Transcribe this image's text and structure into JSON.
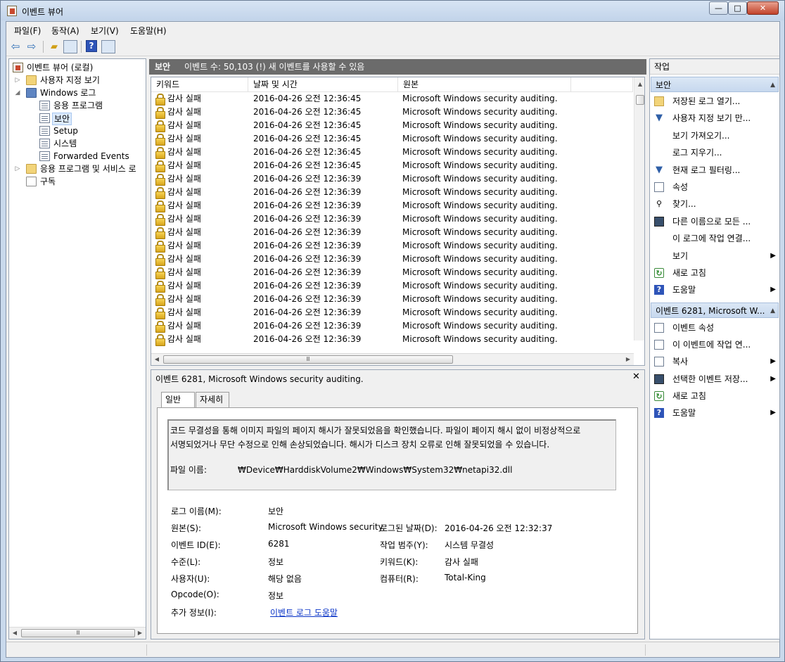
{
  "window": {
    "title": "이벤트 뷰어",
    "minimize": "—",
    "maximize": "□",
    "close": "✕"
  },
  "menu": [
    "파일(F)",
    "동작(A)",
    "보기(V)",
    "도움말(H)"
  ],
  "toolbar": {
    "back_icon": "back-arrow-icon",
    "forward_icon": "forward-arrow-icon",
    "help": "?"
  },
  "tree": {
    "root": "이벤트 뷰어 (로컬)",
    "custom_views": "사용자 지정 보기",
    "windows_logs": "Windows 로그",
    "logs": [
      "응용 프로그램",
      "보안",
      "Setup",
      "시스템",
      "Forwarded Events"
    ],
    "app_services": "응용 프로그램 및 서비스 로",
    "subscriptions": "구독"
  },
  "center": {
    "log_name": "보안",
    "count_text": "이벤트 수: 50,103 (!) 새 이벤트를 사용할 수 있음",
    "columns": [
      "키워드",
      "날짜 및 시간",
      "원본"
    ],
    "rows": [
      {
        "keyword": "감사 실패",
        "datetime": "2016-04-26 오전 12:36:45",
        "source": "Microsoft Windows security auditing."
      },
      {
        "keyword": "감사 실패",
        "datetime": "2016-04-26 오전 12:36:45",
        "source": "Microsoft Windows security auditing."
      },
      {
        "keyword": "감사 실패",
        "datetime": "2016-04-26 오전 12:36:45",
        "source": "Microsoft Windows security auditing."
      },
      {
        "keyword": "감사 실패",
        "datetime": "2016-04-26 오전 12:36:45",
        "source": "Microsoft Windows security auditing."
      },
      {
        "keyword": "감사 실패",
        "datetime": "2016-04-26 오전 12:36:45",
        "source": "Microsoft Windows security auditing."
      },
      {
        "keyword": "감사 실패",
        "datetime": "2016-04-26 오전 12:36:45",
        "source": "Microsoft Windows security auditing."
      },
      {
        "keyword": "감사 실패",
        "datetime": "2016-04-26 오전 12:36:39",
        "source": "Microsoft Windows security auditing."
      },
      {
        "keyword": "감사 실패",
        "datetime": "2016-04-26 오전 12:36:39",
        "source": "Microsoft Windows security auditing."
      },
      {
        "keyword": "감사 실패",
        "datetime": "2016-04-26 오전 12:36:39",
        "source": "Microsoft Windows security auditing."
      },
      {
        "keyword": "감사 실패",
        "datetime": "2016-04-26 오전 12:36:39",
        "source": "Microsoft Windows security auditing."
      },
      {
        "keyword": "감사 실패",
        "datetime": "2016-04-26 오전 12:36:39",
        "source": "Microsoft Windows security auditing."
      },
      {
        "keyword": "감사 실패",
        "datetime": "2016-04-26 오전 12:36:39",
        "source": "Microsoft Windows security auditing."
      },
      {
        "keyword": "감사 실패",
        "datetime": "2016-04-26 오전 12:36:39",
        "source": "Microsoft Windows security auditing."
      },
      {
        "keyword": "감사 실패",
        "datetime": "2016-04-26 오전 12:36:39",
        "source": "Microsoft Windows security auditing."
      },
      {
        "keyword": "감사 실패",
        "datetime": "2016-04-26 오전 12:36:39",
        "source": "Microsoft Windows security auditing."
      },
      {
        "keyword": "감사 실패",
        "datetime": "2016-04-26 오전 12:36:39",
        "source": "Microsoft Windows security auditing."
      },
      {
        "keyword": "감사 실패",
        "datetime": "2016-04-26 오전 12:36:39",
        "source": "Microsoft Windows security auditing."
      },
      {
        "keyword": "감사 실패",
        "datetime": "2016-04-26 오전 12:36:39",
        "source": "Microsoft Windows security auditing."
      },
      {
        "keyword": "감사 실패",
        "datetime": "2016-04-26 오전 12:36:39",
        "source": "Microsoft Windows security auditing."
      }
    ]
  },
  "detail": {
    "title": "이벤트 6281, Microsoft Windows security auditing.",
    "close": "✕",
    "tabs": [
      "일반",
      "자세히"
    ],
    "description_line1": "코드 무결성을 통해 이미지 파일의 페이지 해시가 잘못되었음을 확인했습니다. 파일이 페이지 해시 없이 비정상적으로",
    "description_line2": "서명되었거나 무단 수정으로 인해 손상되었습니다. 해시가 디스크 장치 오류로 인해 잘못되었을 수 있습니다.",
    "file_label": "파일 이름:",
    "file_value": "₩Device₩HarddiskVolume2₩Windows₩System32₩netapi32.dll",
    "props": {
      "log_name_label": "로그 이름(M):",
      "log_name": "보안",
      "source_label": "원본(S):",
      "source": "Microsoft Windows security",
      "logged_label": "로그된 날짜(D):",
      "logged": "2016-04-26 오전 12:32:37",
      "event_id_label": "이벤트 ID(E):",
      "event_id": "6281",
      "task_label": "작업 범주(Y):",
      "task": "시스템 무결성",
      "level_label": "수준(L):",
      "level": "정보",
      "keywords_label": "키워드(K):",
      "keywords": "감사 실패",
      "user_label": "사용자(U):",
      "user": "해당 없음",
      "computer_label": "컴퓨터(R):",
      "computer": "Total-King",
      "opcode_label": "Opcode(O):",
      "opcode": "정보",
      "more_info_label": "추가 정보(I):",
      "more_info": "이벤트 로그 도움말"
    }
  },
  "actions": {
    "title": "작업",
    "section1": "보안",
    "section1_items": [
      "저장된 로그 열기...",
      "사용자 지정 보기 만...",
      "보기 가져오기...",
      "로그 지우기...",
      "현재 로그 필터링...",
      "속성",
      "찾기...",
      "다른 이름으로 모든 ...",
      "이 로그에 작업 연결...",
      "보기",
      "새로 고침",
      "도움말"
    ],
    "section2": "이벤트 6281, Microsoft W...",
    "section2_items": [
      "이벤트 속성",
      "이 이벤트에 작업 연...",
      "복사",
      "선택한 이벤트 저장...",
      "새로 고침",
      "도움말"
    ]
  },
  "scroll_glyph": "Ⅲ"
}
